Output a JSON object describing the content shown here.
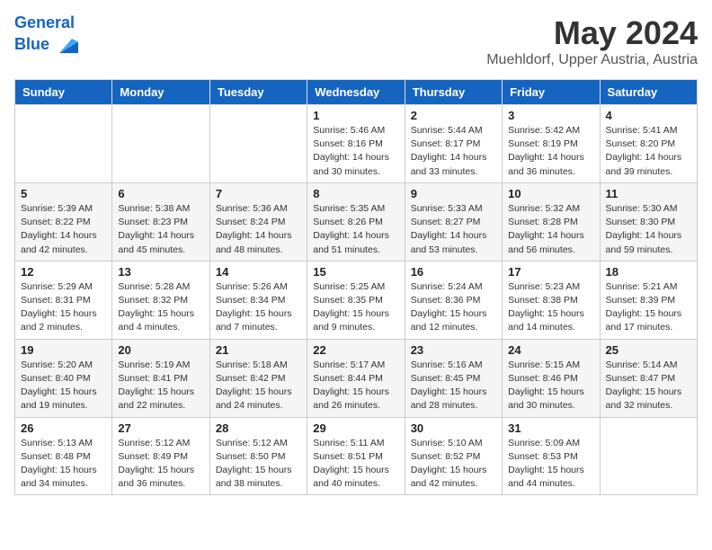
{
  "logo": {
    "line1": "General",
    "line2": "Blue"
  },
  "title": "May 2024",
  "subtitle": "Muehldorf, Upper Austria, Austria",
  "weekdays": [
    "Sunday",
    "Monday",
    "Tuesday",
    "Wednesday",
    "Thursday",
    "Friday",
    "Saturday"
  ],
  "weeks": [
    [
      {
        "day": "",
        "info": ""
      },
      {
        "day": "",
        "info": ""
      },
      {
        "day": "",
        "info": ""
      },
      {
        "day": "1",
        "info": "Sunrise: 5:46 AM\nSunset: 8:16 PM\nDaylight: 14 hours\nand 30 minutes."
      },
      {
        "day": "2",
        "info": "Sunrise: 5:44 AM\nSunset: 8:17 PM\nDaylight: 14 hours\nand 33 minutes."
      },
      {
        "day": "3",
        "info": "Sunrise: 5:42 AM\nSunset: 8:19 PM\nDaylight: 14 hours\nand 36 minutes."
      },
      {
        "day": "4",
        "info": "Sunrise: 5:41 AM\nSunset: 8:20 PM\nDaylight: 14 hours\nand 39 minutes."
      }
    ],
    [
      {
        "day": "5",
        "info": "Sunrise: 5:39 AM\nSunset: 8:22 PM\nDaylight: 14 hours\nand 42 minutes."
      },
      {
        "day": "6",
        "info": "Sunrise: 5:38 AM\nSunset: 8:23 PM\nDaylight: 14 hours\nand 45 minutes."
      },
      {
        "day": "7",
        "info": "Sunrise: 5:36 AM\nSunset: 8:24 PM\nDaylight: 14 hours\nand 48 minutes."
      },
      {
        "day": "8",
        "info": "Sunrise: 5:35 AM\nSunset: 8:26 PM\nDaylight: 14 hours\nand 51 minutes."
      },
      {
        "day": "9",
        "info": "Sunrise: 5:33 AM\nSunset: 8:27 PM\nDaylight: 14 hours\nand 53 minutes."
      },
      {
        "day": "10",
        "info": "Sunrise: 5:32 AM\nSunset: 8:28 PM\nDaylight: 14 hours\nand 56 minutes."
      },
      {
        "day": "11",
        "info": "Sunrise: 5:30 AM\nSunset: 8:30 PM\nDaylight: 14 hours\nand 59 minutes."
      }
    ],
    [
      {
        "day": "12",
        "info": "Sunrise: 5:29 AM\nSunset: 8:31 PM\nDaylight: 15 hours\nand 2 minutes."
      },
      {
        "day": "13",
        "info": "Sunrise: 5:28 AM\nSunset: 8:32 PM\nDaylight: 15 hours\nand 4 minutes."
      },
      {
        "day": "14",
        "info": "Sunrise: 5:26 AM\nSunset: 8:34 PM\nDaylight: 15 hours\nand 7 minutes."
      },
      {
        "day": "15",
        "info": "Sunrise: 5:25 AM\nSunset: 8:35 PM\nDaylight: 15 hours\nand 9 minutes."
      },
      {
        "day": "16",
        "info": "Sunrise: 5:24 AM\nSunset: 8:36 PM\nDaylight: 15 hours\nand 12 minutes."
      },
      {
        "day": "17",
        "info": "Sunrise: 5:23 AM\nSunset: 8:38 PM\nDaylight: 15 hours\nand 14 minutes."
      },
      {
        "day": "18",
        "info": "Sunrise: 5:21 AM\nSunset: 8:39 PM\nDaylight: 15 hours\nand 17 minutes."
      }
    ],
    [
      {
        "day": "19",
        "info": "Sunrise: 5:20 AM\nSunset: 8:40 PM\nDaylight: 15 hours\nand 19 minutes."
      },
      {
        "day": "20",
        "info": "Sunrise: 5:19 AM\nSunset: 8:41 PM\nDaylight: 15 hours\nand 22 minutes."
      },
      {
        "day": "21",
        "info": "Sunrise: 5:18 AM\nSunset: 8:42 PM\nDaylight: 15 hours\nand 24 minutes."
      },
      {
        "day": "22",
        "info": "Sunrise: 5:17 AM\nSunset: 8:44 PM\nDaylight: 15 hours\nand 26 minutes."
      },
      {
        "day": "23",
        "info": "Sunrise: 5:16 AM\nSunset: 8:45 PM\nDaylight: 15 hours\nand 28 minutes."
      },
      {
        "day": "24",
        "info": "Sunrise: 5:15 AM\nSunset: 8:46 PM\nDaylight: 15 hours\nand 30 minutes."
      },
      {
        "day": "25",
        "info": "Sunrise: 5:14 AM\nSunset: 8:47 PM\nDaylight: 15 hours\nand 32 minutes."
      }
    ],
    [
      {
        "day": "26",
        "info": "Sunrise: 5:13 AM\nSunset: 8:48 PM\nDaylight: 15 hours\nand 34 minutes."
      },
      {
        "day": "27",
        "info": "Sunrise: 5:12 AM\nSunset: 8:49 PM\nDaylight: 15 hours\nand 36 minutes."
      },
      {
        "day": "28",
        "info": "Sunrise: 5:12 AM\nSunset: 8:50 PM\nDaylight: 15 hours\nand 38 minutes."
      },
      {
        "day": "29",
        "info": "Sunrise: 5:11 AM\nSunset: 8:51 PM\nDaylight: 15 hours\nand 40 minutes."
      },
      {
        "day": "30",
        "info": "Sunrise: 5:10 AM\nSunset: 8:52 PM\nDaylight: 15 hours\nand 42 minutes."
      },
      {
        "day": "31",
        "info": "Sunrise: 5:09 AM\nSunset: 8:53 PM\nDaylight: 15 hours\nand 44 minutes."
      },
      {
        "day": "",
        "info": ""
      }
    ]
  ]
}
